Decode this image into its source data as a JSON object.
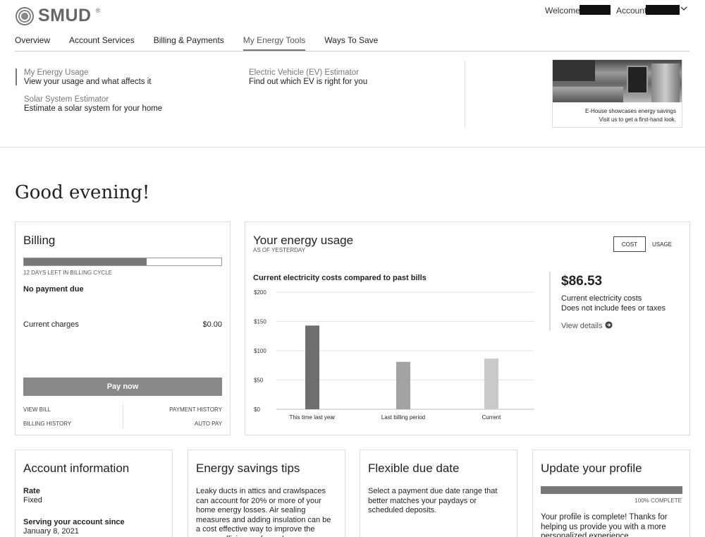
{
  "header": {
    "logo_text": "SMUD",
    "logo_reg": "®",
    "welcome_label": "Welcome,",
    "account_label": "Account",
    "account_chevron": "chevron-down-icon"
  },
  "nav": {
    "items": [
      {
        "label": "Overview"
      },
      {
        "label": "Account Services"
      },
      {
        "label": "Billing & Payments"
      },
      {
        "label": "My Energy Tools"
      },
      {
        "label": "Ways To Save"
      }
    ],
    "active_index": 3
  },
  "menu": {
    "col1": [
      {
        "link": "My Energy Usage",
        "desc": "View your usage and what affects it"
      },
      {
        "link": "Solar System Estimator",
        "desc": "Estimate a solar system for your home"
      }
    ],
    "col2": [
      {
        "link": "Electric Vehicle (EV) Estimator",
        "desc": "Find out which EV is right for you"
      }
    ],
    "promo": {
      "line1": "E-House showcases energy savings",
      "line2": "Visit us to get a first-hand look."
    }
  },
  "greeting": "Good evening!",
  "billing": {
    "title": "Billing",
    "progress_fraction": 0.62,
    "days_left": "12 DAYS LEFT IN BILLING CYCLE",
    "payment_status": "No payment due",
    "charges_label": "Current charges",
    "charges_value": "$0.00",
    "pay_button": "Pay now",
    "links": {
      "view_bill": "VIEW BILL",
      "payment_history": "PAYMENT HISTORY",
      "billing_history": "BILLING HISTORY",
      "auto_pay": "AUTO PAY"
    }
  },
  "energy": {
    "title": "Your energy usage",
    "subtitle": "AS OF YESTERDAY",
    "toggle": {
      "cost": "COST",
      "usage": "USAGE",
      "active": "cost"
    },
    "cost_value": "$86.53",
    "cost_line1": "Current electricity costs",
    "cost_line2": "Does not include fees or taxes",
    "view_details": "View details",
    "view_details_icon": "arrow-circle-right-icon"
  },
  "chart_data": {
    "type": "bar",
    "title": "Current electricity costs compared to past bills",
    "categories": [
      "This time last year",
      "Last billing period",
      "Current"
    ],
    "values": [
      143,
      81,
      86.53
    ],
    "bar_colors": [
      "#6f6f6f",
      "#a3a3a3",
      "#c9c9c9"
    ],
    "ylim": [
      0,
      200
    ],
    "yticks": [
      0,
      50,
      100,
      150,
      200
    ],
    "ytick_labels": [
      "$0",
      "$50",
      "$100",
      "$150",
      "$200"
    ],
    "grid": true
  },
  "cards": {
    "account": {
      "title": "Account information",
      "rate_label": "Rate",
      "rate_value": "Fixed",
      "since_label": "Serving your account since",
      "since_value": "January 8, 2021"
    },
    "tips": {
      "title": "Energy savings tips",
      "text": "Leaky ducts in attics and crawlspaces can account for 20% or more of your home energy losses. Air sealing measures and adding insulation can be a cost effective way to improve the energy efficiency of your home."
    },
    "flex": {
      "title": "Flexible due date",
      "text": "Select a payment due date range that better matches your paydays or scheduled deposits."
    },
    "profile": {
      "title": "Update your profile",
      "progress_fraction": 1.0,
      "complete_label": "100% COMPLETE",
      "text": "Your profile is complete! Thanks for helping us provide you with a more personalized experience."
    }
  }
}
